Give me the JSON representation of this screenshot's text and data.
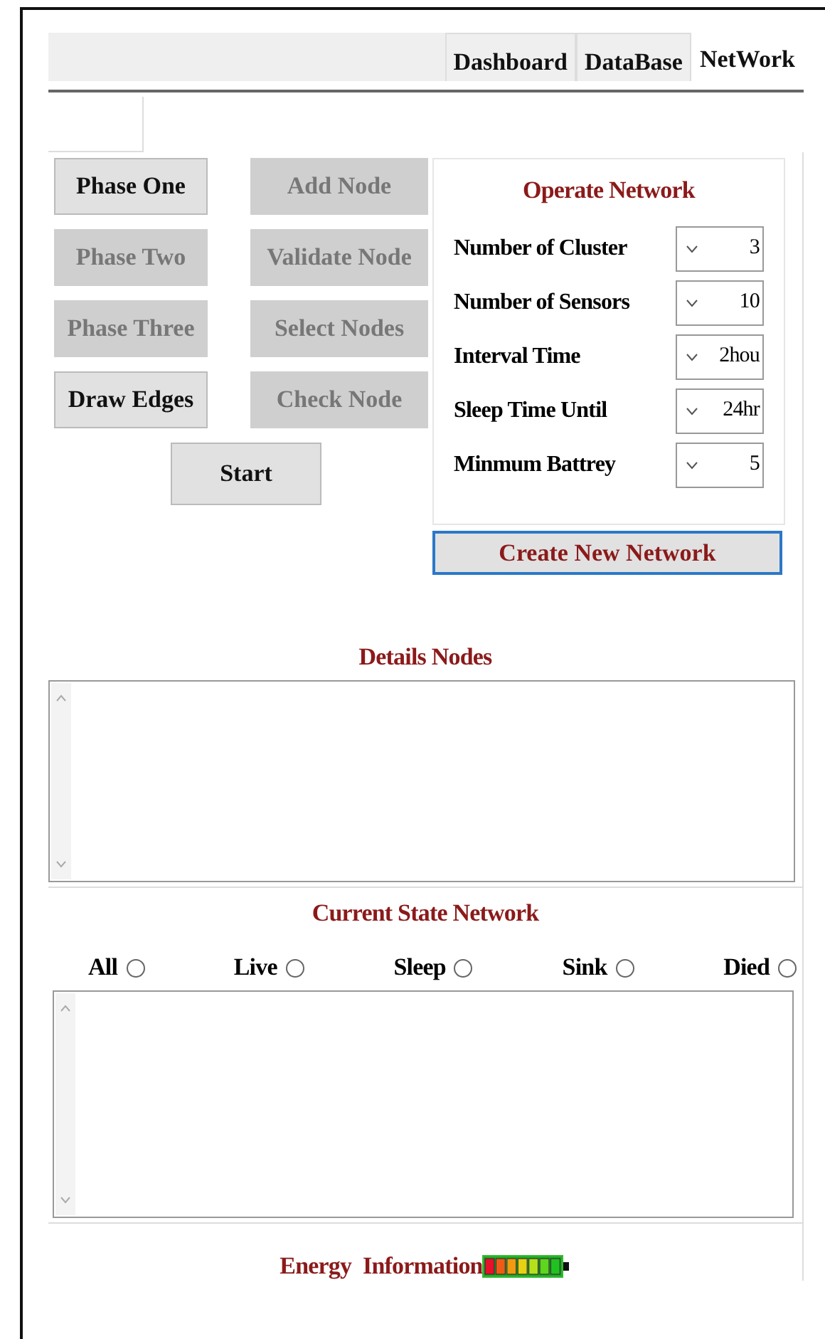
{
  "tabs": [
    {
      "label": "Dashboard",
      "selected": false
    },
    {
      "label": "DataBase",
      "selected": false
    },
    {
      "label": "NetWork",
      "selected": true
    }
  ],
  "phase_buttons": [
    {
      "label": "Phase One",
      "disabled": false
    },
    {
      "label": "Phase Two",
      "disabled": true
    },
    {
      "label": "Phase Three",
      "disabled": true
    },
    {
      "label": "Draw Edges",
      "disabled": false
    }
  ],
  "node_buttons": [
    {
      "label": "Add Node",
      "disabled": true
    },
    {
      "label": "Validate Node",
      "disabled": true
    },
    {
      "label": "Select Nodes",
      "disabled": true
    },
    {
      "label": "Check Node",
      "disabled": true
    }
  ],
  "start_button": {
    "label": "Start",
    "disabled": false
  },
  "operate_network": {
    "title": "Operate Network",
    "fields": [
      {
        "label": "Number of Cluster",
        "value": "3"
      },
      {
        "label": "Number of Sensors",
        "value": "10"
      },
      {
        "label": "Interval Time",
        "value": "2hou"
      },
      {
        "label": "Sleep Time Until",
        "value": "24hr"
      },
      {
        "label": "Minmum Battrey",
        "value": "5"
      }
    ]
  },
  "create_button": {
    "label": "Create New Network"
  },
  "details_nodes": {
    "title": "Details Nodes"
  },
  "current_state": {
    "title": "Current State Network",
    "filters": [
      {
        "label": "All",
        "selected": false
      },
      {
        "label": "Live",
        "selected": false
      },
      {
        "label": "Sleep",
        "selected": false
      },
      {
        "label": "Sink",
        "selected": false
      },
      {
        "label": "Died",
        "selected": false
      }
    ]
  },
  "energy": {
    "title": "Energy Information"
  }
}
